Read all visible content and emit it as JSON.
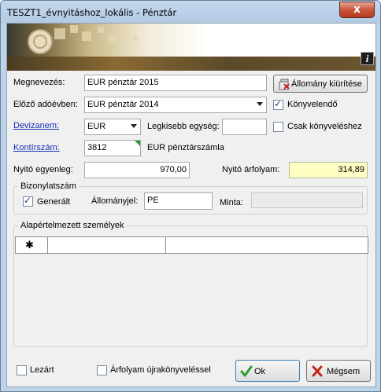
{
  "window": {
    "title": "TESZT1_évnyitáshoz_lokális - Pénztár",
    "close_glyph": "x"
  },
  "banner": {
    "info_glyph": "i"
  },
  "form": {
    "name_label": "Megnevezés:",
    "name_value": "EUR pénztár 2015",
    "clear_button": "Állomány kiürítése",
    "prev_label": "Előző adóévben:",
    "prev_value": "EUR pénztár 2014",
    "bookable_label": "Könyvelendő",
    "bookable_checked": true,
    "currency_label": "Devizanem:",
    "currency_value": "EUR",
    "smallest_unit_label": "Legkisebb egység:",
    "smallest_unit_value": "",
    "only_booking_label": "Csak könyveléshez",
    "only_booking_checked": false,
    "account_label": "Kontírszám:",
    "account_value": "3812",
    "account_desc": "EUR pénztárszámla",
    "opening_balance_label": "Nyitó egyenleg:",
    "opening_balance_value": "970,00",
    "opening_rate_label": "Nyitó árfolyam:",
    "opening_rate_value": "314,89"
  },
  "voucher": {
    "group_title": "Bizonylatszám",
    "generated_label": "Generált",
    "generated_checked": true,
    "file_mark_label": "Állományjel:",
    "file_mark_value": "PE",
    "sample_label": "Minta:",
    "sample_value": ""
  },
  "persons": {
    "group_title": "Alapértelmezett személyek",
    "new_row_glyph": "✱"
  },
  "footer": {
    "closed_label": "Lezárt",
    "closed_checked": false,
    "rebook_label": "Árfolyam újrakönyveléssel",
    "rebook_checked": false,
    "ok_label": "Ok",
    "cancel_label": "Mégsem"
  },
  "colors": {
    "link": "#1530b8",
    "rate_field_bg": "#ffffc4",
    "ok_icon": "#2e9b2e",
    "cancel_icon": "#c0281e"
  }
}
